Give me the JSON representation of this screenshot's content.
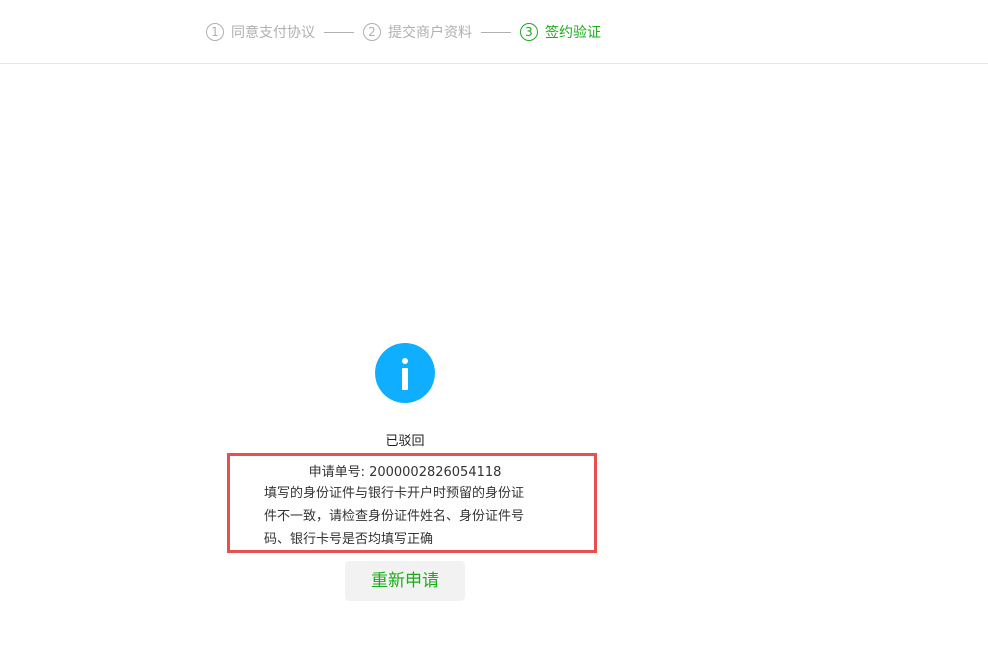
{
  "steps": [
    {
      "num": "1",
      "label": "同意支付协议",
      "active": false
    },
    {
      "num": "2",
      "label": "提交商户资料",
      "active": false
    },
    {
      "num": "3",
      "label": "签约验证",
      "active": true
    }
  ],
  "result": {
    "icon": "info-icon",
    "icon_color": "#10aeff",
    "status": "已驳回",
    "application_no": "申请单号: 2000002826054118",
    "reason_lines": [
      "填写的身份证件与银行卡开户时预留的身份证",
      "件不一致，请检查身份证件姓名、身份证件号",
      "码、银行卡号是否均填写正确"
    ],
    "highlight_color": "#e85050"
  },
  "actions": {
    "reapply_label": "重新申请"
  },
  "colors": {
    "accent": "#1aad19",
    "inactive": "#b0b0b0"
  }
}
